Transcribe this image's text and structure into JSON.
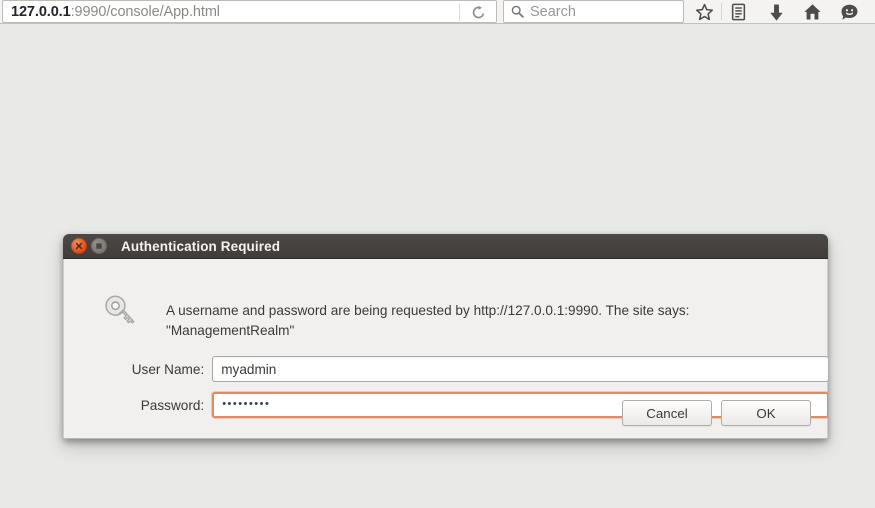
{
  "browser": {
    "url_bar": {
      "host": "127.0.0.1",
      "path": ":9990/console/App.html",
      "full_url": "127.0.0.1:9990/console/App.html"
    },
    "reload_icon": "reload-icon",
    "search": {
      "placeholder": "Search",
      "value": "",
      "icon": "search-icon"
    },
    "toolbar_icons": [
      {
        "name": "bookmark-star-icon",
        "glyph": "star"
      },
      {
        "name": "reader-list-icon",
        "glyph": "list"
      },
      {
        "name": "downloads-icon",
        "glyph": "down-arrow"
      },
      {
        "name": "home-icon",
        "glyph": "house"
      },
      {
        "name": "feedback-smiley-icon",
        "glyph": "smiley"
      }
    ]
  },
  "dialog": {
    "title": "Authentication Required",
    "window_buttons": {
      "close": "close-icon",
      "maximize": "maximize-icon"
    },
    "icon": "key-icon",
    "message": "A username and password are being requested by http://127.0.0.1:9990. The site says: \"ManagementRealm\"",
    "fields": [
      {
        "label": "User Name:",
        "value": "myadmin",
        "type": "text",
        "focused": false,
        "name": "username"
      },
      {
        "label": "Password:",
        "value": "•••••••••",
        "type": "password",
        "focused": true,
        "name": "password"
      }
    ],
    "buttons": [
      {
        "label": "Cancel",
        "name": "cancel"
      },
      {
        "label": "OK",
        "name": "ok"
      }
    ]
  },
  "colors": {
    "page_background": "#e9e9e7",
    "toolbar_background": "#f4f3f2",
    "dialog_titlebar": "#453f3c",
    "dialog_body": "#f1f0ee",
    "close_button_accent": "#dd4814",
    "focus_border": "#e28a64"
  }
}
